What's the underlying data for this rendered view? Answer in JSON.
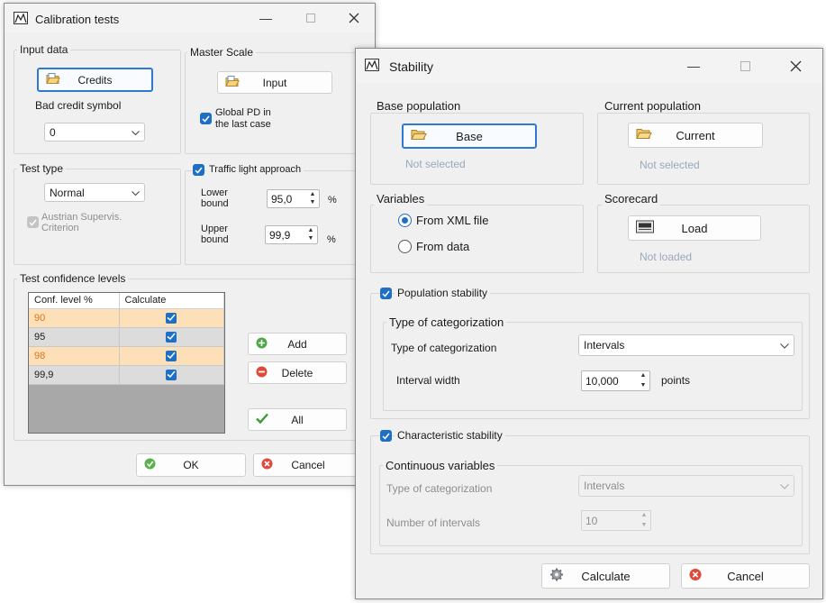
{
  "calibration": {
    "title": "Calibration tests",
    "input_data": {
      "group_label": "Input data",
      "credits_button": "Credits",
      "bad_credit_label": "Bad credit symbol",
      "bad_credit_value": "0"
    },
    "master_scale": {
      "group_label": "Master Scale",
      "input_button": "Input",
      "global_pd_label_line1": "Global PD in",
      "global_pd_label_line2": "the last case"
    },
    "test_type": {
      "group_label": "Test type",
      "value": "Normal",
      "austrian_line1": "Austrian Supervis.",
      "austrian_line2": "Criterion"
    },
    "traffic_light": {
      "label": "Traffic light approach",
      "lower_label_line1": "Lower",
      "lower_label_line2": "bound",
      "lower_value": "95,0",
      "upper_label_line1": "Upper",
      "upper_label_line2": "bound",
      "upper_value": "99,9",
      "unit": "%"
    },
    "confidence": {
      "group_label": "Test confidence levels",
      "col_level": "Conf. level %",
      "col_calc": "Calculate",
      "rows": [
        {
          "level": "90",
          "calculate": true
        },
        {
          "level": "95",
          "calculate": true
        },
        {
          "level": "98",
          "calculate": true
        },
        {
          "level": "99,9",
          "calculate": true
        }
      ],
      "add_button": "Add",
      "delete_button": "Delete",
      "all_button": "All"
    },
    "ok_button": "OK",
    "cancel_button": "Cancel"
  },
  "stability": {
    "title": "Stability",
    "base_population": {
      "group_label": "Base population",
      "button": "Base",
      "status": "Not selected"
    },
    "current_population": {
      "group_label": "Current population",
      "button": "Current",
      "status": "Not selected"
    },
    "variables": {
      "group_label": "Variables",
      "from_xml": "From XML file",
      "from_data": "From data"
    },
    "scorecard": {
      "group_label": "Scorecard",
      "button": "Load",
      "status": "Not loaded"
    },
    "population_stability": {
      "label": "Population stability",
      "sub_group_label": "Type of categorization",
      "type_label": "Type of categorization",
      "type_value": "Intervals",
      "width_label": "Interval width",
      "width_value": "10,000",
      "width_unit": "points"
    },
    "characteristic_stability": {
      "label": "Characteristic stability",
      "sub_group_label": "Continuous variables",
      "type_label": "Type of categorization",
      "type_value": "Intervals",
      "number_label": "Number of intervals",
      "number_value": "10"
    },
    "calculate_button": "Calculate",
    "cancel_button": "Cancel"
  },
  "colors": {
    "accent": "#1f6fc5",
    "highlight_row": "#fde0b8",
    "muted_text": "#99a9bd"
  }
}
